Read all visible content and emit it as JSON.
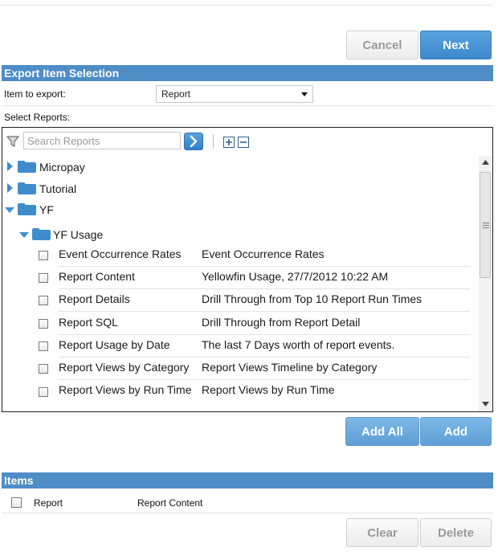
{
  "wizard": {
    "cancel_label": "Cancel",
    "next_label": "Next"
  },
  "export_section": {
    "title": "Export Item Selection",
    "item_to_export_label": "Item to export:",
    "item_to_export_value": "Report",
    "select_reports_label": "Select Reports:"
  },
  "search": {
    "placeholder": "Search Reports"
  },
  "tree": {
    "folders": [
      {
        "name": "Micropay",
        "expanded": false
      },
      {
        "name": "Tutorial",
        "expanded": false
      },
      {
        "name": "YF",
        "expanded": true
      },
      {
        "name": "YF Usage",
        "expanded": true
      }
    ],
    "reports": [
      {
        "name": "Event Occurrence Rates",
        "description": "Event Occurrence Rates",
        "checked": false
      },
      {
        "name": "Report Content",
        "description": "Yellowfin Usage, 27/7/2012 10:22 AM",
        "checked": false
      },
      {
        "name": "Report Details",
        "description": "Drill Through from Top 10 Report Run Times",
        "checked": false
      },
      {
        "name": "Report SQL",
        "description": "Drill Through from Report Detail",
        "checked": false
      },
      {
        "name": "Report Usage by Date",
        "description": "The last 7 Days worth of report events.",
        "checked": false
      },
      {
        "name": "Report Views by Category",
        "description": "Report Views Timeline by Category",
        "checked": false
      },
      {
        "name": "Report Views by Run Time",
        "description": "Report Views by Run Time",
        "checked": false
      }
    ]
  },
  "add_buttons": {
    "add_all_label": "Add All",
    "add_label": "Add"
  },
  "items_section": {
    "title": "Items",
    "rows": [
      {
        "type": "Report",
        "name": "Report Content",
        "checked": false
      }
    ]
  },
  "bottom_buttons": {
    "clear_label": "Clear",
    "delete_label": "Delete"
  },
  "colors": {
    "section_bar": "#4e8dc6",
    "primary_button": "#4a94d6",
    "folder": "#3f8ccd"
  }
}
